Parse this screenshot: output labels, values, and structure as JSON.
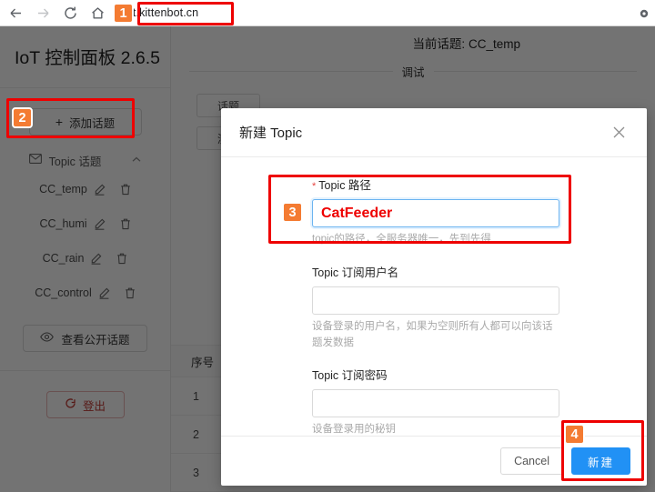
{
  "browser": {
    "url": "iot.kittenbot.cn",
    "back_icon": "arrow-left-icon",
    "forward_icon": "arrow-right-icon",
    "reload_icon": "reload-icon",
    "home_icon": "home-icon",
    "menu_icon": "more-options-icon"
  },
  "sidebar": {
    "brand": "IoT 控制面板 2.6.5",
    "add_topic_label": "添加话题",
    "add_topic_plus": "+",
    "group": {
      "label": "Topic 话题",
      "icon": "mail-icon",
      "chevron": "chevron-up-icon"
    },
    "topics": [
      {
        "name": "CC_temp"
      },
      {
        "name": "CC_humi"
      },
      {
        "name": "CC_rain"
      },
      {
        "name": "CC_control"
      }
    ],
    "public_topics_label": "查看公开话题",
    "logout_label": "登出"
  },
  "main": {
    "current_topic_prefix": "当前话题:",
    "current_topic_value": "CC_temp",
    "debug_label": "调试",
    "ghost_buttons": [
      {
        "label": "话题"
      },
      {
        "label": "测试"
      }
    ],
    "table": {
      "columns": [
        "序号"
      ],
      "rows": [
        {
          "index": "1"
        },
        {
          "index": "2"
        },
        {
          "index": "3"
        }
      ]
    }
  },
  "modal": {
    "title": "新建 Topic",
    "close_icon": "close-icon",
    "fields": [
      {
        "label": "Topic 路径",
        "required": true,
        "required_marker": "*",
        "value": "CatFeeder",
        "placeholder": "",
        "hint": "topic的路径，全服务器唯一，先到先得",
        "focused": true
      },
      {
        "label": "Topic 订阅用户名",
        "required": false,
        "required_marker": "",
        "value": "",
        "placeholder": "",
        "hint": "设备登录的用户名，如果为空则所有人都可以向该话题发数据",
        "focused": false
      },
      {
        "label": "Topic 订阅密码",
        "required": false,
        "required_marker": "",
        "value": "",
        "placeholder": "",
        "hint": "设备登录用的秘钥",
        "focused": false
      }
    ],
    "cancel_label": "Cancel",
    "submit_label": "新建"
  },
  "annotations": {
    "colors": {
      "box": "#ee0000",
      "badge": "#f47b32"
    },
    "steps": [
      {
        "number": "1",
        "target": "address-bar"
      },
      {
        "number": "2",
        "target": "add-topic-button"
      },
      {
        "number": "3",
        "target": "topic-path-input"
      },
      {
        "number": "4",
        "target": "submit-button"
      }
    ]
  }
}
